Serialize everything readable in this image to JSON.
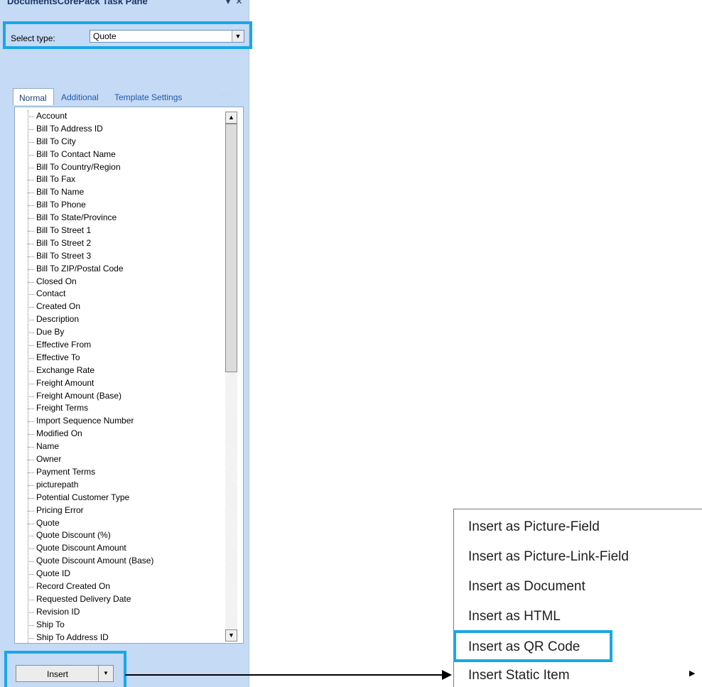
{
  "pane": {
    "title": "DocumentsCorePack Task Pane",
    "controls": "▾ ✕",
    "select_label": "Select type:",
    "select_value": "Quote",
    "tabs": [
      "Normal",
      "Additional",
      "Template Settings"
    ],
    "fields": [
      "Account",
      "Bill To Address ID",
      "Bill To City",
      "Bill To Contact Name",
      "Bill To Country/Region",
      "Bill To Fax",
      "Bill To Name",
      "Bill To Phone",
      "Bill To State/Province",
      "Bill To Street 1",
      "Bill To Street 2",
      "Bill To Street 3",
      "Bill To ZIP/Postal Code",
      "Closed On",
      "Contact",
      "Created On",
      "Description",
      "Due By",
      "Effective From",
      "Effective To",
      "Exchange Rate",
      "Freight Amount",
      "Freight Amount (Base)",
      "Freight Terms",
      "Import Sequence Number",
      "Modified On",
      "Name",
      "Owner",
      "Payment Terms",
      "picturepath",
      "Potential Customer Type",
      "Pricing Error",
      "Quote",
      "Quote Discount (%)",
      "Quote Discount Amount",
      "Quote Discount Amount (Base)",
      "Quote ID",
      "Record Created On",
      "Requested Delivery Date",
      "Revision ID",
      "Ship To",
      "Ship To Address ID"
    ],
    "insert_label": "Insert"
  },
  "menu": {
    "items": [
      "Insert as Picture-Field",
      "Insert as Picture-Link-Field",
      "Insert as Document",
      "Insert as HTML",
      "Insert as QR Code",
      "Insert Static Item"
    ]
  },
  "colors": {
    "highlight": "#1aa7e6",
    "pane_background": "#c5daf5",
    "tab_text": "#1f5aa8"
  }
}
